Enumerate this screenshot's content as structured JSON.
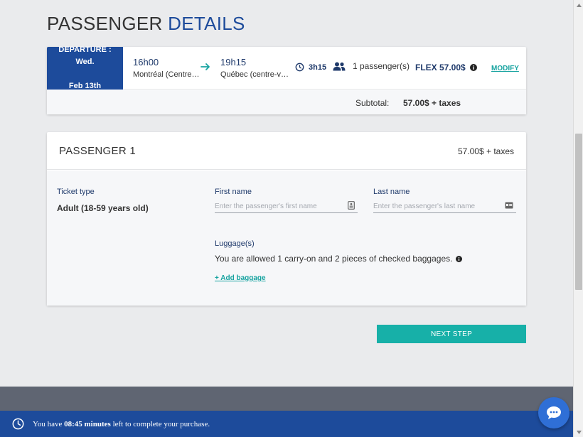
{
  "page": {
    "title_plain": "PASSENGER",
    "title_accent": "DETAILS"
  },
  "trip": {
    "departure_line1": "DEPARTURE : Wed.",
    "departure_line2": "Feb 13th",
    "depart_time": "16h00",
    "depart_place": "Montréal (Centre…",
    "arrive_time": "19h15",
    "arrive_place": "Québec (centre-v…",
    "duration": "3h15",
    "passengers": "1 passenger(s)",
    "fare": "FLEX 57.00$",
    "modify_label": "MODIFY",
    "subtotal_label": "Subtotal:",
    "subtotal_value": "57.00$ + taxes"
  },
  "passenger": {
    "title": "PASSENGER 1",
    "price": "57.00$ + taxes",
    "ticket_type_label": "Ticket type",
    "ticket_type_value": "Adult (18-59 years old)",
    "first_name_label": "First name",
    "first_name_placeholder": "Enter the passenger's first name",
    "first_name_value": "",
    "last_name_label": "Last name",
    "last_name_placeholder": "Enter the passenger's last name",
    "last_name_value": "",
    "luggage_label": "Luggage(s)",
    "luggage_text": "You are allowed 1 carry-on and 2 pieces of checked baggages.",
    "add_baggage_label": "+ Add baggage"
  },
  "actions": {
    "next_step_label": "NEXT STEP"
  },
  "timer": {
    "prefix": "You have",
    "time": "08:45 minutes",
    "suffix": "left to complete your purchase."
  },
  "colors": {
    "brand_blue": "#1d4b9b",
    "accent_teal": "#17b0a8",
    "chat_blue": "#2f6fd6"
  },
  "icons": {
    "arrow": "arrow-right-icon",
    "duration": "clock-icon",
    "passengers": "people-icon",
    "fare_info": "info-icon",
    "first_name": "id-card-icon",
    "last_name": "id-card-icon",
    "luggage_info": "info-icon",
    "timer": "clock-icon",
    "chat": "chat-bubble-icon"
  }
}
